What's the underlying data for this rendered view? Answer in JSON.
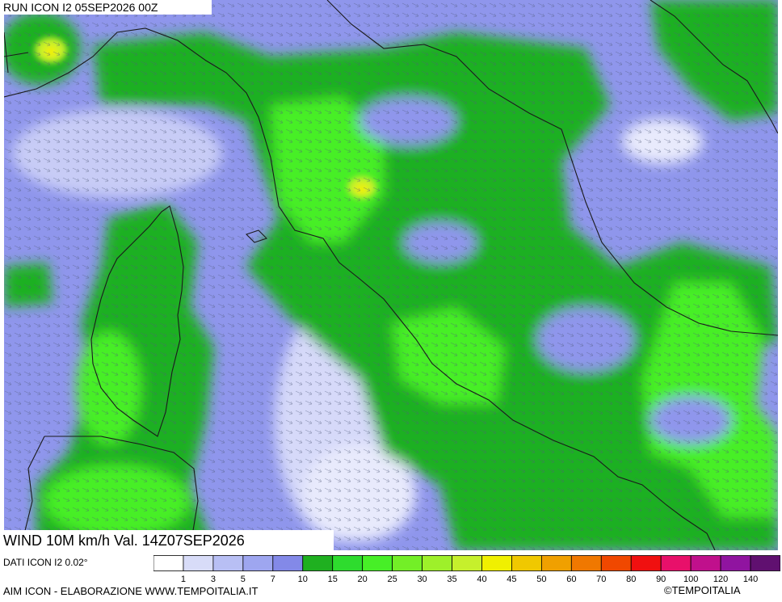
{
  "header": {
    "run_label": "RUN ICON I2 05SEP2026 00Z"
  },
  "footer": {
    "variable_label": "WIND 10M km/h Val. 14Z07SEP2026",
    "data_label": "DATI ICON I2 0.02°",
    "credit_label": "AIM ICON - ELABORAZIONE WWW.TEMPOITALIA.IT",
    "copyright_label": "©TEMPOITALIA"
  },
  "legend": {
    "unit": "km/h",
    "ticks": [
      "1",
      "3",
      "5",
      "7",
      "10",
      "15",
      "20",
      "25",
      "30",
      "35",
      "40",
      "45",
      "50",
      "60",
      "70",
      "80",
      "90",
      "100",
      "120",
      "140"
    ],
    "colors": [
      "#ffffff",
      "#d8dcf8",
      "#b8bff4",
      "#9ea6f0",
      "#8389e8",
      "#1fb020",
      "#2edc2e",
      "#47ef27",
      "#73ef27",
      "#9ef02a",
      "#c6f02c",
      "#f0f000",
      "#f0c800",
      "#f0a000",
      "#f07800",
      "#f04800",
      "#f01010",
      "#e8106a",
      "#c0108c",
      "#9014a0",
      "#601070"
    ]
  },
  "map": {
    "region": "Italia centrale",
    "field_colors": {
      "calm": "#e8eafc",
      "light": "#8f96ec",
      "breeze": "#1fb020",
      "moderate": "#47ef27",
      "fresh": "#c6f02c",
      "strong": "#f0f000",
      "coast": "#1a1a1a"
    }
  }
}
